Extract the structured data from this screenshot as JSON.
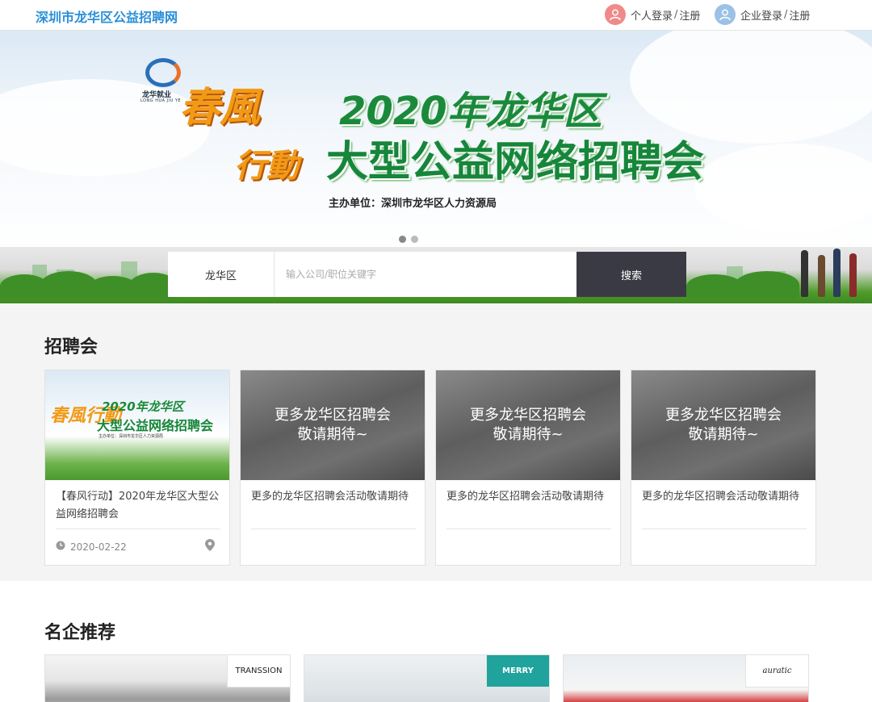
{
  "header": {
    "site_title": "深圳市龙华区公益招聘网",
    "personal_login": "个人登录",
    "company_login": "企业登录",
    "separator": "/",
    "register": "注册"
  },
  "banner": {
    "logo_text": "龙华就业",
    "logo_subtext": "LONG HUA JIU YE",
    "spring_line1": "春風",
    "spring_line2": "行動",
    "headline_line1": "2020年龙华区",
    "headline_line2": "大型公益网络招聘会",
    "organizer": "主办单位：深圳市龙华区人力资源局",
    "slide_count": 2,
    "active_slide": 1
  },
  "search": {
    "area": "龙华区",
    "placeholder": "输入公司/职位关键字",
    "value": "",
    "button": "搜索"
  },
  "job_fairs": {
    "title": "招聘会",
    "poster": {
      "spring": "春風行動",
      "line1": "2020年龙华区",
      "line2": "大型公益网络招聘会",
      "organizer": "主办单位：深圳市龙华区人力资源局"
    },
    "more_overlay_line1": "更多龙华区招聘会",
    "more_overlay_line2": "敬请期待~",
    "cards": [
      {
        "title": "【春风行动】2020年龙华区大型公益网络招聘会",
        "date": "2020-02-22"
      },
      {
        "title": "更多的龙华区招聘会活动敬请期待"
      },
      {
        "title": "更多的龙华区招聘会活动敬请期待"
      },
      {
        "title": "更多的龙华区招聘会活动敬请期待"
      }
    ]
  },
  "companies": {
    "title": "名企推荐",
    "items": [
      {
        "logo": "TRANSSION"
      },
      {
        "logo": "MERRY"
      },
      {
        "logo": "auratic"
      }
    ]
  },
  "icons": {
    "personal": "user-icon",
    "company": "user-icon",
    "date": "clock-icon",
    "location": "location-pin-icon"
  },
  "colors": {
    "site_title": "#2a8fd8",
    "search_button": "#3a3a44",
    "banner_green": "#16863a",
    "banner_orange": "#f29a16",
    "personal_avatar": "#f08a8a",
    "company_avatar": "#9cc1e6"
  }
}
